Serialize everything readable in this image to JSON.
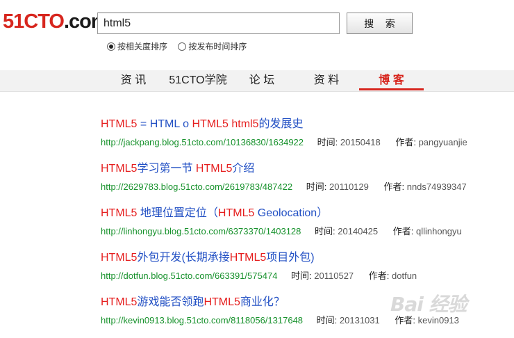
{
  "logo": {
    "num": "51CTO",
    "suffix": ".com"
  },
  "search": {
    "value": "html5",
    "button_label": "搜 索",
    "sort_options": [
      {
        "label": "按相关度排序",
        "checked": true
      },
      {
        "label": "按发布时间排序",
        "checked": false
      }
    ]
  },
  "nav": {
    "tabs": [
      {
        "label": "资 讯"
      },
      {
        "label": "51CTO学院"
      },
      {
        "label": "论 坛"
      },
      {
        "label": "资 料"
      },
      {
        "label": "博 客",
        "active": true
      }
    ]
  },
  "labels": {
    "time": "时间: ",
    "author": "作者: "
  },
  "results": [
    {
      "title_parts": [
        {
          "text": "HTML5",
          "hl": true
        },
        {
          "text": " = HTML o ",
          "hl": false
        },
        {
          "text": "HTML5",
          "hl": true
        },
        {
          "text": " ",
          "hl": false
        },
        {
          "text": "html5",
          "hl": true
        },
        {
          "text": "的发展史",
          "hl": false
        }
      ],
      "url": "http://jackpang.blog.51cto.com/10136830/1634922",
      "time": "20150418",
      "author": "pangyuanjie"
    },
    {
      "title_parts": [
        {
          "text": "HTML5",
          "hl": true
        },
        {
          "text": "学习第一节 ",
          "hl": false
        },
        {
          "text": "HTML5",
          "hl": true
        },
        {
          "text": "介绍",
          "hl": false
        }
      ],
      "url": "http://2629783.blog.51cto.com/2619783/487422",
      "time": "20110129",
      "author": "nnds74939347"
    },
    {
      "title_parts": [
        {
          "text": "HTML5",
          "hl": true
        },
        {
          "text": " 地理位置定位（",
          "hl": false
        },
        {
          "text": "HTML5",
          "hl": true
        },
        {
          "text": " Geolocation）",
          "hl": false
        }
      ],
      "url": "http://linhongyu.blog.51cto.com/6373370/1403128",
      "time": "20140425",
      "author": "qllinhongyu"
    },
    {
      "title_parts": [
        {
          "text": "HTML5",
          "hl": true
        },
        {
          "text": "外包开发(长期承接",
          "hl": false
        },
        {
          "text": "HTML5",
          "hl": true
        },
        {
          "text": "项目外包)",
          "hl": false
        }
      ],
      "url": "http://dotfun.blog.51cto.com/663391/575474",
      "time": "20110527",
      "author": "dotfun"
    },
    {
      "title_parts": [
        {
          "text": "HTML5",
          "hl": true
        },
        {
          "text": "游戏能否领跑",
          "hl": false
        },
        {
          "text": "HTML5",
          "hl": true
        },
        {
          "text": "商业化？",
          "hl": false
        }
      ],
      "url": "http://kevin0913.blog.51cto.com/8118056/1317648",
      "time": "20131031",
      "author": "kevin0913"
    }
  ],
  "watermark": "Bai 经验",
  "colors": {
    "brand_red": "#d7261e",
    "link_blue": "#2250c4",
    "highlight_red": "#e51d1d",
    "url_green": "#16912b"
  }
}
